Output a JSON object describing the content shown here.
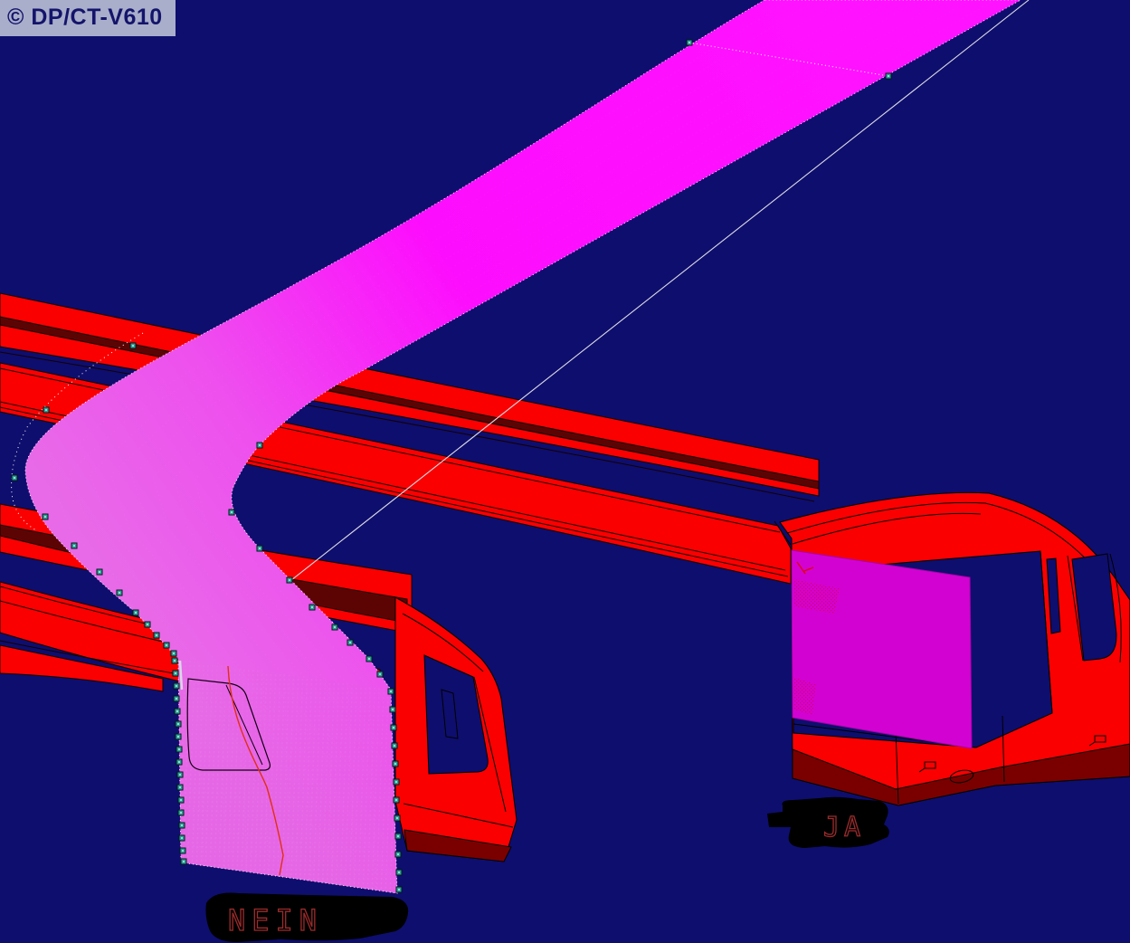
{
  "viewport": {
    "badge_label": "© DP/CT-V610",
    "annotations": {
      "nein": "NEIN",
      "ja": "JA"
    },
    "colors": {
      "background": "#0E0E6E",
      "surface_magenta_bright": "#FF12FF",
      "surface_magenta_shaded": "#E86AE8",
      "panel_magenta": "#C03CC0",
      "square_magenta": "#D203D2",
      "body_red": "#FA0000",
      "dark_face_maroon": "#7A0000",
      "rail_stripe_maroon": "#5C0404",
      "edge_black": "#000000",
      "wireframe_white": "#FFFFFF",
      "control_point_teal": "#2E9E96",
      "annotation_text_red": "#9B2B2B",
      "annotation_blob_black": "#000000",
      "badge_background": "#A9AECB",
      "badge_text": "#14146B"
    }
  }
}
